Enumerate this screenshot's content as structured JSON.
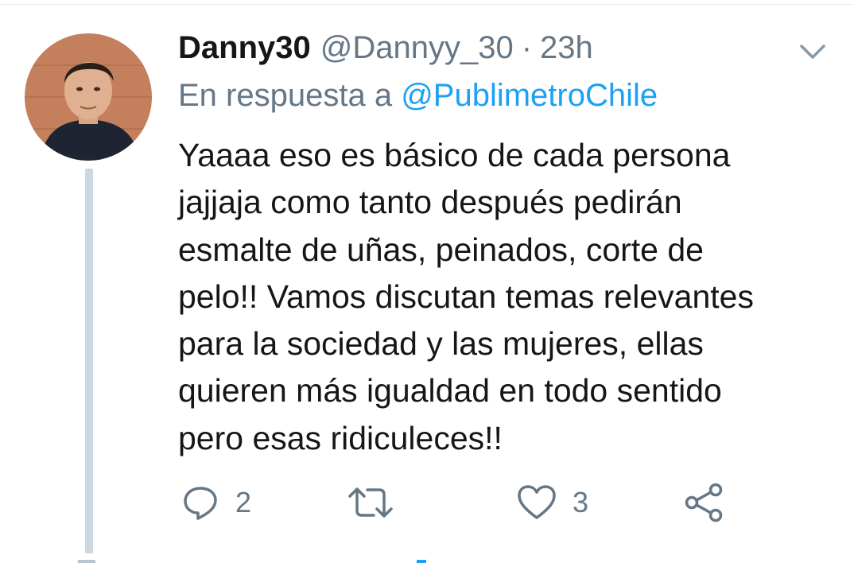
{
  "tweet": {
    "display_name": "Danny30",
    "handle": "@Dannyy_30",
    "separator": "·",
    "time": "23h",
    "reply_prefix": "En respuesta a",
    "reply_mention": "@PublimetroChile",
    "text": "Yaaaa eso es básico de cada persona\njajjaja como tanto después pedirán\nesmalte de uñas, peinados, corte de\npelo!! Vamos discutan temas relevantes\npara la sociedad y las mujeres, ellas\nquieren más igualdad en todo sentido\npero esas ridiculeces!!"
  },
  "actions": {
    "reply": {
      "icon": "reply-icon",
      "count": "2"
    },
    "retweet": {
      "icon": "retweet-icon",
      "count": ""
    },
    "like": {
      "icon": "heart-icon",
      "count": "3"
    },
    "share": {
      "icon": "share-icon"
    }
  },
  "colors": {
    "text": "#14171a",
    "secondary": "#657786",
    "link": "#1da1f2",
    "thread_line": "#cdd7e0"
  }
}
